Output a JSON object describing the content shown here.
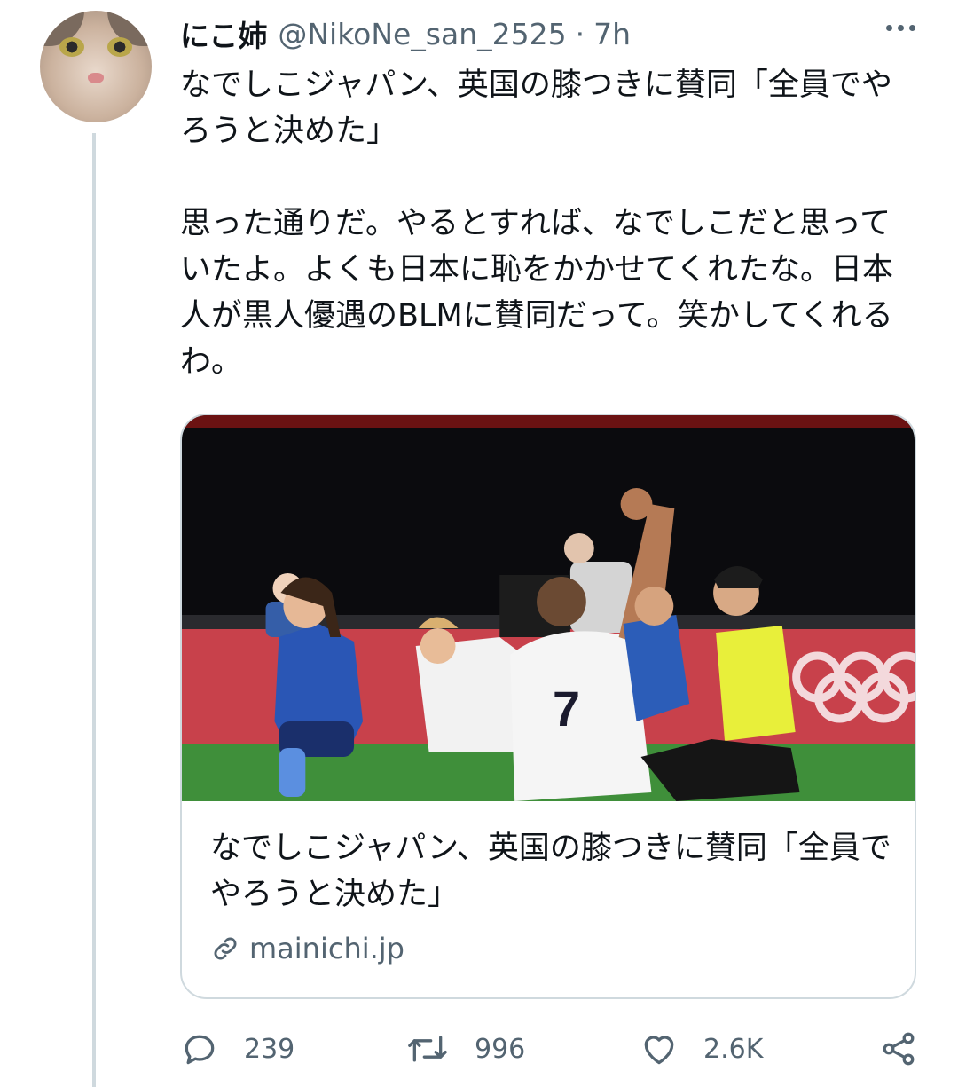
{
  "tweet": {
    "display_name": "にこ姉",
    "handle": "@NikoNe_san_2525",
    "separator": "·",
    "time": "7h",
    "avatar_icon": "cat-photo-avatar",
    "text": "なでしこジャパン、英国の膝つきに賛同「全員でやろうと決めた」\n\n思った通りだ。やるとすれば、なでしこだと思っていたよ。よくも日本に恥をかかせてくれたな。日本人が黒人優遇のBLMに賛同だって。笑かしてくれるわ。"
  },
  "card": {
    "title": "なでしこジャパン、英国の膝つきに賛同「全員でやろうと決めた」",
    "domain": "mainichi.jp",
    "link_icon": "link-icon",
    "image_description_icon": "photo"
  },
  "actions": {
    "reply": {
      "icon": "reply-icon",
      "count": "239"
    },
    "retweet": {
      "icon": "retweet-icon",
      "count": "996"
    },
    "like": {
      "icon": "heart-icon",
      "count": "2.6K"
    },
    "share": {
      "icon": "share-icon"
    }
  },
  "colors": {
    "text_primary": "#0f1419",
    "text_secondary": "#536471",
    "border": "#cfd9de"
  }
}
